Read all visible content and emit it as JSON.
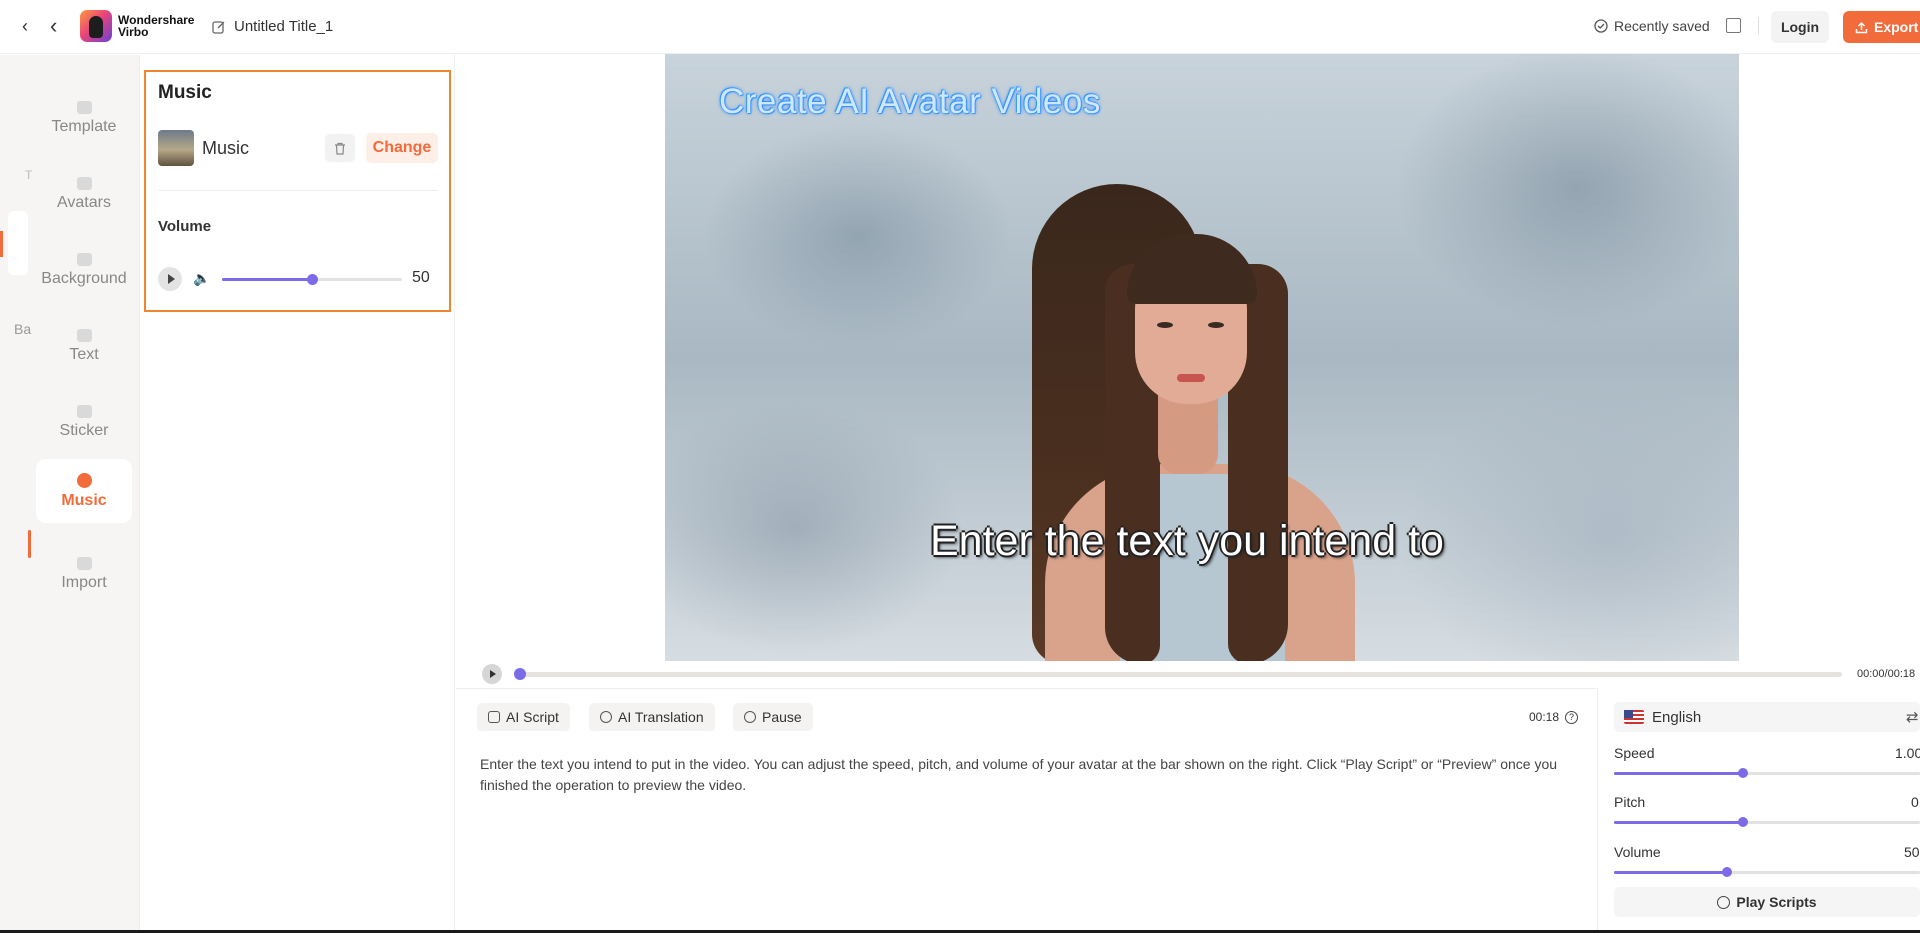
{
  "topbar": {
    "back_glyph": "‹",
    "back_glyph2": "‹",
    "brand_line1": "Wondershare",
    "brand_line2": "Virbo",
    "doc_title": "Untitled Title_1",
    "saved_status": "Recently saved",
    "login_label": "Login",
    "export_label": "Export"
  },
  "leftnav": {
    "ghost_left_t": "T",
    "ghost_left_b": "Ba",
    "items": [
      {
        "label": "Template",
        "icon": "template-icon"
      },
      {
        "label": "Avatars",
        "icon": "avatar-icon"
      },
      {
        "label": "Background",
        "icon": "background-icon"
      },
      {
        "label": "Text",
        "icon": "text-icon"
      },
      {
        "label": "Sticker",
        "icon": "sticker-icon"
      },
      {
        "label": "Music",
        "icon": "music-icon",
        "active": true
      },
      {
        "label": "Import",
        "icon": "import-icon"
      }
    ]
  },
  "music_panel": {
    "title": "Music",
    "track_name": "Music",
    "change_label": "Change",
    "volume_label": "Volume",
    "volume_value": "50",
    "volume_level": 0.5
  },
  "video": {
    "title_text": "Create AI Avatar Videos",
    "subtitle_text": "Enter the text you intend to"
  },
  "timeline": {
    "time": "00:00/00:18",
    "progress": 0
  },
  "script": {
    "tools": [
      {
        "label": "AI Script",
        "icon": "ai-script-icon"
      },
      {
        "label": "AI Translation",
        "icon": "ai-translation-icon"
      },
      {
        "label": "Pause",
        "icon": "pause-clock-icon"
      }
    ],
    "duration": "00:18",
    "help_glyph": "?",
    "body": "Enter the text you intend to put in the video. You can adjust the speed, pitch, and volume of your avatar at the bar shown on the right. Click “Play Script” or “Preview” once you finished the operation to preview the video."
  },
  "voice": {
    "language": "English",
    "speed_label": "Speed",
    "speed_value": "1.00",
    "speed_level": 0.42,
    "pitch_label": "Pitch",
    "pitch_value": "0",
    "pitch_level": 0.42,
    "volume_label": "Volume",
    "volume_value": "50",
    "volume_level": 0.37,
    "play_label": "Play Scripts"
  },
  "colors": {
    "accent": "#f26b3a",
    "slider": "#7b6be6",
    "highlight_frame": "#f0852f"
  }
}
